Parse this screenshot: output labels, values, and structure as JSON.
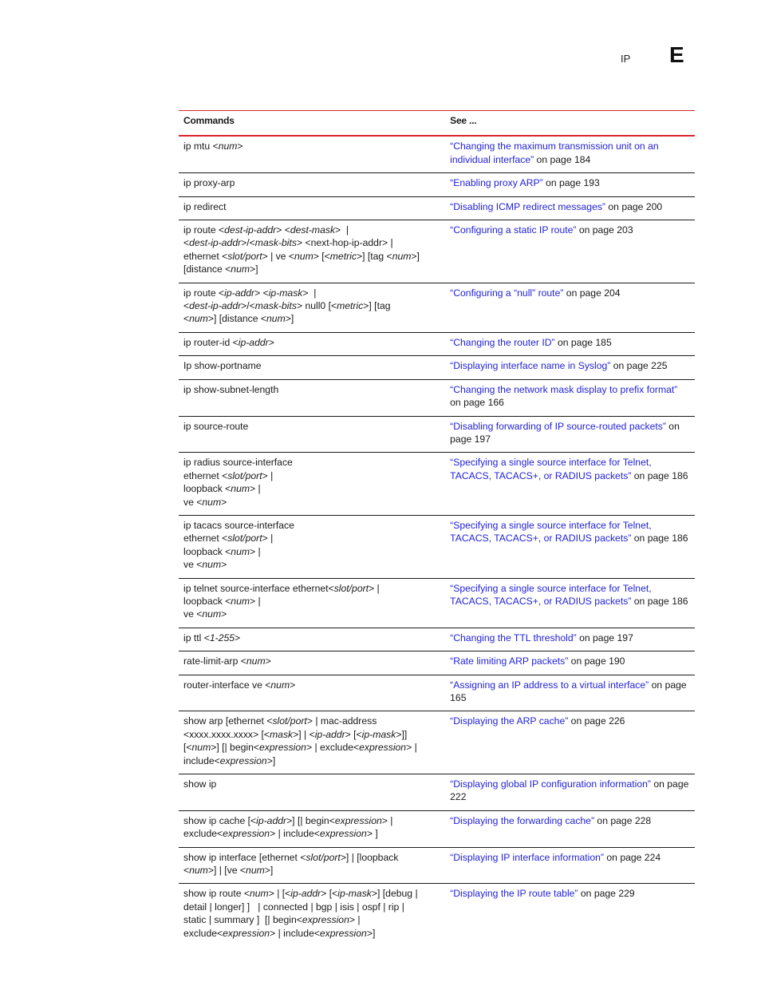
{
  "header": {
    "section": "IP",
    "appendix_letter": "E"
  },
  "table": {
    "columns": [
      "Commands",
      "See ..."
    ],
    "rows": [
      {
        "command": [
          [
            [
              "ip mtu <",
              false
            ],
            [
              "num",
              true
            ],
            [
              ">",
              false
            ]
          ]
        ],
        "link": "“Changing the maximum transmission unit on an individual interface”",
        "page": " on page 184"
      },
      {
        "command": [
          [
            [
              "ip proxy-arp",
              false
            ]
          ]
        ],
        "link": "“Enabling proxy ARP”",
        "page": " on page 193"
      },
      {
        "command": [
          [
            [
              "ip redirect",
              false
            ]
          ]
        ],
        "link": "“Disabling ICMP redirect messages”",
        "page": " on page 200"
      },
      {
        "command": [
          [
            [
              "ip route <",
              false
            ],
            [
              "dest-ip-addr",
              true
            ],
            [
              "> <",
              false
            ],
            [
              "dest-mask",
              true
            ],
            [
              ">  |",
              false
            ]
          ],
          [
            [
              "<",
              false
            ],
            [
              "dest-ip-addr",
              true
            ],
            [
              ">/<",
              false
            ],
            [
              "mask-bits",
              true
            ],
            [
              "> <next-hop-ip-addr> |",
              false
            ]
          ],
          [
            [
              "ethernet <",
              false
            ],
            [
              "slot/port",
              true
            ],
            [
              "> | ve <",
              false
            ],
            [
              "num",
              true
            ],
            [
              "> [<",
              false
            ],
            [
              "metric",
              true
            ],
            [
              ">] [tag <",
              false
            ],
            [
              "num",
              true
            ],
            [
              ">]",
              false
            ]
          ],
          [
            [
              "[distance <",
              false
            ],
            [
              "num",
              true
            ],
            [
              ">]",
              false
            ]
          ]
        ],
        "link": "“Configuring a static IP route”",
        "page": " on page 203"
      },
      {
        "command": [
          [
            [
              "ip route <",
              false
            ],
            [
              "ip-addr",
              true
            ],
            [
              "> <",
              false
            ],
            [
              "ip-mask",
              true
            ],
            [
              ">  |",
              false
            ]
          ],
          [
            [
              "<",
              false
            ],
            [
              "dest-ip-addr",
              true
            ],
            [
              ">/<",
              false
            ],
            [
              "mask-bits",
              true
            ],
            [
              "> null0 [<",
              false
            ],
            [
              "metric",
              true
            ],
            [
              ">] [tag",
              false
            ]
          ],
          [
            [
              "<",
              false
            ],
            [
              "num",
              true
            ],
            [
              ">] [distance <",
              false
            ],
            [
              "num",
              true
            ],
            [
              ">]",
              false
            ]
          ]
        ],
        "link": "“Configuring a “null” route”",
        "page": " on page 204"
      },
      {
        "command": [
          [
            [
              "ip router-id <",
              false
            ],
            [
              "ip-addr",
              true
            ],
            [
              ">",
              false
            ]
          ]
        ],
        "link": "“Changing the router ID”",
        "page": " on page 185"
      },
      {
        "command": [
          [
            [
              "Ip show-portname",
              false
            ]
          ]
        ],
        "link": "“Displaying interface name in Syslog”",
        "page": " on page 225"
      },
      {
        "command": [
          [
            [
              "ip show-subnet-length",
              false
            ]
          ]
        ],
        "link": "“Changing the network mask display to prefix format”",
        "page": " on page 166"
      },
      {
        "command": [
          [
            [
              "ip source-route",
              false
            ]
          ]
        ],
        "link": "“Disabling forwarding of IP source-routed packets”",
        "page": " on page 197"
      },
      {
        "command": [
          [
            [
              "ip radius source-interface",
              false
            ]
          ],
          [
            [
              "ethernet <",
              false
            ],
            [
              "slot/port",
              true
            ],
            [
              "> |",
              false
            ]
          ],
          [
            [
              "loopback <",
              false
            ],
            [
              "num",
              true
            ],
            [
              "> |",
              false
            ]
          ],
          [
            [
              "ve <",
              false
            ],
            [
              "num",
              true
            ],
            [
              ">",
              false
            ]
          ]
        ],
        "link": "“Specifying a single source interface for Telnet, TACACS, TACACS+, or RADIUS packets”",
        "page": " on page 186"
      },
      {
        "command": [
          [
            [
              "ip tacacs source-interface",
              false
            ]
          ],
          [
            [
              "ethernet <",
              false
            ],
            [
              "slot/port",
              true
            ],
            [
              "> |",
              false
            ]
          ],
          [
            [
              "loopback <",
              false
            ],
            [
              "num",
              true
            ],
            [
              "> |",
              false
            ]
          ],
          [
            [
              "ve <",
              false
            ],
            [
              "num",
              true
            ],
            [
              ">",
              false
            ]
          ]
        ],
        "link": "“Specifying a single source interface for Telnet, TACACS, TACACS+, or RADIUS packets”",
        "page": " on page 186"
      },
      {
        "command": [
          [
            [
              "ip telnet source-interface ethernet<",
              false
            ],
            [
              "slot/port",
              true
            ],
            [
              "> |",
              false
            ]
          ],
          [
            [
              "loopback <",
              false
            ],
            [
              "num",
              true
            ],
            [
              "> |",
              false
            ]
          ],
          [
            [
              "ve <",
              false
            ],
            [
              "num",
              true
            ],
            [
              ">",
              false
            ]
          ]
        ],
        "link": "“Specifying a single source interface for Telnet, TACACS, TACACS+, or RADIUS packets”",
        "page": " on page 186"
      },
      {
        "command": [
          [
            [
              "ip ttl <",
              false
            ],
            [
              "1-255",
              true
            ],
            [
              ">",
              false
            ]
          ]
        ],
        "link": "“Changing the TTL threshold”",
        "page": " on page 197"
      },
      {
        "command": [
          [
            [
              "rate-limit-arp <",
              false
            ],
            [
              "num",
              true
            ],
            [
              ">",
              false
            ]
          ]
        ],
        "link": "“Rate limiting ARP packets”",
        "page": " on page 190"
      },
      {
        "command": [
          [
            [
              "router-interface ve <",
              false
            ],
            [
              "num",
              true
            ],
            [
              ">",
              false
            ]
          ]
        ],
        "link": "“Assigning an IP address to a virtual interface”",
        "page": " on page 165"
      },
      {
        "command": [
          [
            [
              "show arp [ethernet <",
              false
            ],
            [
              "slot/port",
              true
            ],
            [
              "> | mac-address",
              false
            ]
          ],
          [
            [
              "<xxxx.xxxx.xxxx> [<",
              false
            ],
            [
              "mask",
              true
            ],
            [
              ">] | <",
              false
            ],
            [
              "ip-addr",
              true
            ],
            [
              "> [<",
              false
            ],
            [
              "ip-mask",
              true
            ],
            [
              ">]]",
              false
            ]
          ],
          [
            [
              "[<",
              false
            ],
            [
              "num",
              true
            ],
            [
              ">] [| begin<",
              false
            ],
            [
              "expression",
              true
            ],
            [
              "> | exclude<",
              false
            ],
            [
              "expression",
              true
            ],
            [
              "> |",
              false
            ]
          ],
          [
            [
              "include<",
              false
            ],
            [
              "expression",
              true
            ],
            [
              ">]",
              false
            ]
          ]
        ],
        "link": "“Displaying the ARP cache”",
        "page": " on page 226"
      },
      {
        "command": [
          [
            [
              "show ip",
              false
            ]
          ]
        ],
        "link": "“Displaying global IP configuration information”",
        "page": " on page 222"
      },
      {
        "command": [
          [
            [
              "show ip cache [<",
              false
            ],
            [
              "ip-addr",
              true
            ],
            [
              ">] [| begin<",
              false
            ],
            [
              "expression",
              true
            ],
            [
              "> |",
              false
            ]
          ],
          [
            [
              "exclude<",
              false
            ],
            [
              "expression",
              true
            ],
            [
              "> | include<",
              false
            ],
            [
              "expression",
              true
            ],
            [
              "> ]",
              false
            ]
          ]
        ],
        "link": "“Displaying the forwarding cache”",
        "page": " on page 228"
      },
      {
        "command": [
          [
            [
              "show ip interface [ethernet <",
              false
            ],
            [
              "slot/port",
              true
            ],
            [
              ">] | [loopback",
              false
            ]
          ],
          [
            [
              "<",
              false
            ],
            [
              "num",
              true
            ],
            [
              ">] | [ve <",
              false
            ],
            [
              "num",
              true
            ],
            [
              ">]",
              false
            ]
          ]
        ],
        "link": "“Displaying IP interface information”",
        "page": " on page 224"
      },
      {
        "command": [
          [
            [
              "show ip route <",
              false
            ],
            [
              "num",
              true
            ],
            [
              "> | [<",
              false
            ],
            [
              "ip-addr",
              true
            ],
            [
              "> [<",
              false
            ],
            [
              "ip-mask",
              true
            ],
            [
              ">] [debug |",
              false
            ]
          ],
          [
            [
              "detail | longer] ]   | connected | bgp | isis | ospf | rip |",
              false
            ]
          ],
          [
            [
              "static | summary ]  [| begin<",
              false
            ],
            [
              "expression",
              true
            ],
            [
              "> |",
              false
            ]
          ],
          [
            [
              "exclude<",
              false
            ],
            [
              "expression",
              true
            ],
            [
              "> | include<",
              false
            ],
            [
              "expression",
              true
            ],
            [
              ">]",
              false
            ]
          ]
        ],
        "link": "“Displaying the IP route table”",
        "page": " on page 229"
      }
    ]
  }
}
